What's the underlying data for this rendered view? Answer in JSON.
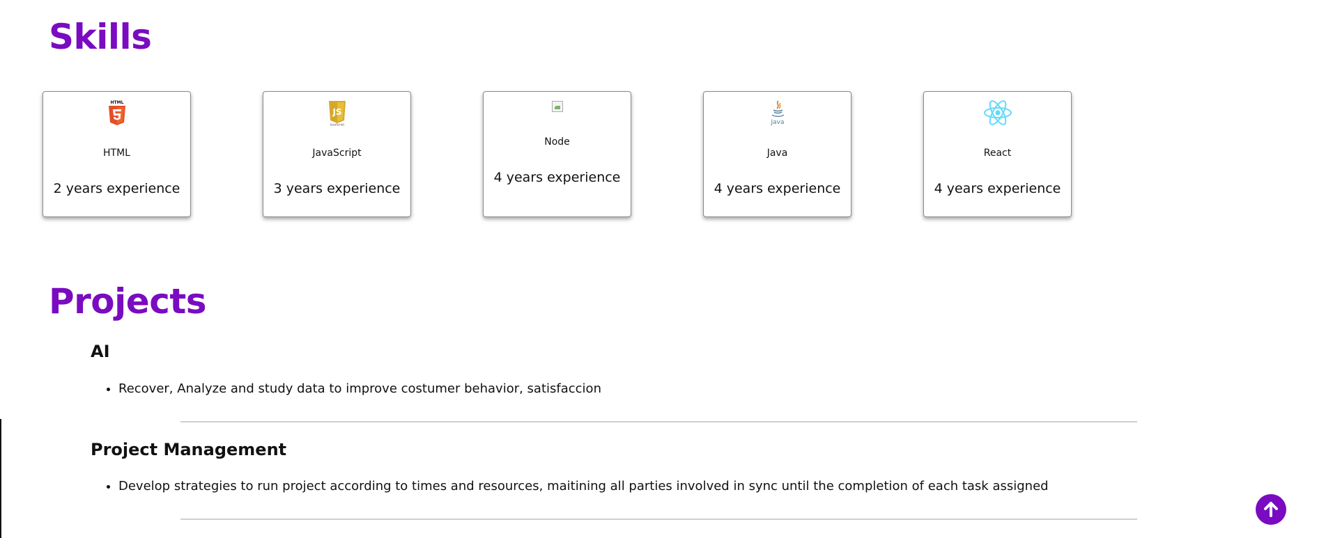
{
  "skills": {
    "title": "Skills",
    "items": [
      {
        "name": "HTML",
        "experience": "2 years experience",
        "icon": "html5-icon",
        "color": "#e34f26"
      },
      {
        "name": "JavaScript",
        "experience": "3 years experience",
        "icon": "javascript-icon",
        "color": "#d4a92a"
      },
      {
        "name": "Node",
        "experience": "4 years experience",
        "icon": "broken-image-icon"
      },
      {
        "name": "Java",
        "experience": "4 years experience",
        "icon": "java-icon",
        "color": "#e76f00"
      },
      {
        "name": "React",
        "experience": "4 years experience",
        "icon": "react-icon",
        "color": "#61dafb"
      }
    ]
  },
  "projects": {
    "title": "Projects",
    "items": [
      {
        "title": "AI",
        "bullets": [
          "Recover, Analyze and study data to improve costumer behavior, satisfaccion"
        ]
      },
      {
        "title": "Project Management",
        "bullets": [
          "Develop strategies to run project according to times and resources, maitining all parties involved in sync until the completion of each task assigned"
        ]
      }
    ]
  },
  "colors": {
    "accent": "#7a0bc0"
  },
  "scroll_top": {
    "icon": "arrow-up-icon"
  }
}
